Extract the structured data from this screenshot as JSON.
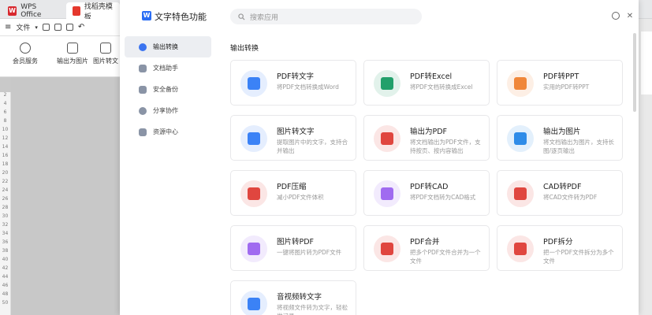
{
  "tabs": [
    {
      "label": "WPS Office"
    },
    {
      "label": "找稻壳模板"
    }
  ],
  "toolbar": {
    "file_menu": "文件"
  },
  "ribbon": [
    {
      "label": "会员服务"
    },
    {
      "label": "输出为图片"
    },
    {
      "label": "图片转文"
    }
  ],
  "dialog": {
    "title": "文字特色功能",
    "search_placeholder": "搜索应用",
    "sidebar": [
      {
        "label": "输出转换",
        "active": true
      },
      {
        "label": "文档助手"
      },
      {
        "label": "安全备份"
      },
      {
        "label": "分享协作"
      },
      {
        "label": "资源中心"
      }
    ],
    "section_title": "输出转换",
    "cards": [
      {
        "name": "PDF转文字",
        "desc": "将PDF文档转换成Word",
        "color": "#3b82f6"
      },
      {
        "name": "PDF转Excel",
        "desc": "将PDF文档转换成Excel",
        "color": "#22a06b"
      },
      {
        "name": "PDF转PPT",
        "desc": "实用的PDF转PPT",
        "color": "#f0873a"
      },
      {
        "name": "图片转文字",
        "desc": "提取图片中的文字，支持合并输出",
        "color": "#3b82f6"
      },
      {
        "name": "输出为PDF",
        "desc": "将文档输出为PDF文件，支持按页、按内容输出",
        "color": "#e0463f"
      },
      {
        "name": "输出为图片",
        "desc": "将文档输出为图片，支持长图/逐页输出",
        "color": "#2f8ce8"
      },
      {
        "name": "PDF压缩",
        "desc": "减小PDF文件体积",
        "color": "#e0463f"
      },
      {
        "name": "PDF转CAD",
        "desc": "将PDF文档转为CAD格式",
        "color": "#a06bf0"
      },
      {
        "name": "CAD转PDF",
        "desc": "将CAD文件转为PDF",
        "color": "#e0463f"
      },
      {
        "name": "图片转PDF",
        "desc": "一键将图片转为PDF文件",
        "color": "#a06bf0"
      },
      {
        "name": "PDF合并",
        "desc": "把多个PDF文件合并为一个文件",
        "color": "#e0463f"
      },
      {
        "name": "PDF拆分",
        "desc": "把一个PDF文件拆分为多个文件",
        "color": "#e0463f"
      },
      {
        "name": "音视频转文字",
        "desc": "将视频文件转为文字，轻松做记录",
        "color": "#3b82f6"
      }
    ]
  }
}
